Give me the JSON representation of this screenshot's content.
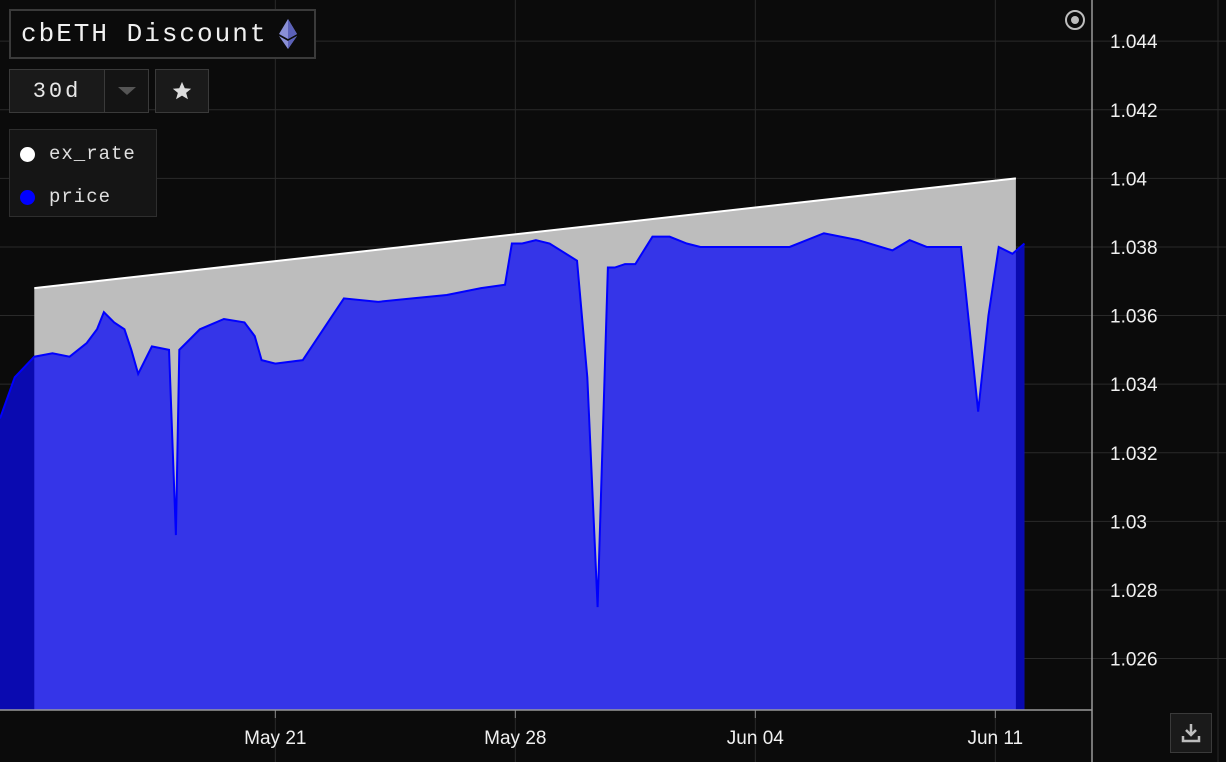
{
  "header": {
    "title": "cbETH Discount",
    "range_label": "30d",
    "icons": {
      "eth": "ethereum-icon",
      "star": "star-icon",
      "caret": "chevron-down-icon",
      "target": "target-icon",
      "download": "download-icon"
    }
  },
  "colors": {
    "background": "#0b0b0b",
    "grid": "#2a2a2a",
    "ex_rate": "#ffffff",
    "ex_rate_fill": "#bdbdbd",
    "price_line": "#0000ff",
    "price_fill": "#3535e8",
    "price_fill_dark": "#0a0ab0"
  },
  "chart_data": {
    "type": "area",
    "title": "cbETH Discount",
    "ylim": [
      1.0245,
      1.0452
    ],
    "y_ticks": [
      "1.026",
      "1.028",
      "1.03",
      "1.032",
      "1.034",
      "1.036",
      "1.038",
      "1.04",
      "1.042",
      "1.044"
    ],
    "x_ticks": [
      {
        "label": "May 21",
        "day": 7
      },
      {
        "label": "May 28",
        "day": 14
      },
      {
        "label": "Jun 04",
        "day": 21
      },
      {
        "label": "Jun 11",
        "day": 28
      }
    ],
    "x_range": [
      -1.03,
      30.82
    ],
    "grid": true,
    "legend_position": "top-left",
    "series": [
      {
        "name": "ex_rate",
        "x": [
          -0.03,
          28.6
        ],
        "values": [
          1.0368,
          1.04
        ]
      },
      {
        "name": "price",
        "x": [
          -1.03,
          -0.6,
          -0.03,
          0.5,
          1.0,
          1.5,
          1.8,
          2.0,
          2.3,
          2.6,
          2.8,
          3.0,
          3.4,
          3.9,
          4.1,
          4.2,
          4.4,
          4.8,
          5.5,
          6.1,
          6.4,
          6.6,
          7.0,
          7.8,
          8.6,
          9.0,
          10.0,
          11.0,
          12.0,
          13.0,
          13.7,
          13.9,
          14.2,
          14.6,
          15.0,
          15.8,
          16.1,
          16.4,
          16.7,
          16.9,
          17.2,
          17.5,
          18.0,
          18.5,
          19.0,
          19.4,
          19.8,
          20.2,
          21.0,
          22.0,
          23.0,
          24.0,
          25.0,
          25.5,
          26.0,
          27.0,
          27.5,
          27.8,
          28.1,
          28.5,
          28.85
        ],
        "values": [
          1.033,
          1.0342,
          1.0348,
          1.0349,
          1.0348,
          1.0352,
          1.0356,
          1.0361,
          1.0358,
          1.0356,
          1.035,
          1.0343,
          1.0351,
          1.035,
          1.0296,
          1.035,
          1.0352,
          1.0356,
          1.0359,
          1.0358,
          1.0354,
          1.0347,
          1.0346,
          1.0347,
          1.0359,
          1.0365,
          1.0364,
          1.0365,
          1.0366,
          1.0368,
          1.0369,
          1.0381,
          1.0381,
          1.0382,
          1.0381,
          1.0376,
          1.0342,
          1.0275,
          1.0374,
          1.0374,
          1.0375,
          1.0375,
          1.0383,
          1.0383,
          1.0381,
          1.038,
          1.038,
          1.038,
          1.038,
          1.038,
          1.0384,
          1.0382,
          1.0379,
          1.0382,
          1.038,
          1.038,
          1.0332,
          1.036,
          1.038,
          1.0378,
          1.0381
        ]
      }
    ]
  }
}
